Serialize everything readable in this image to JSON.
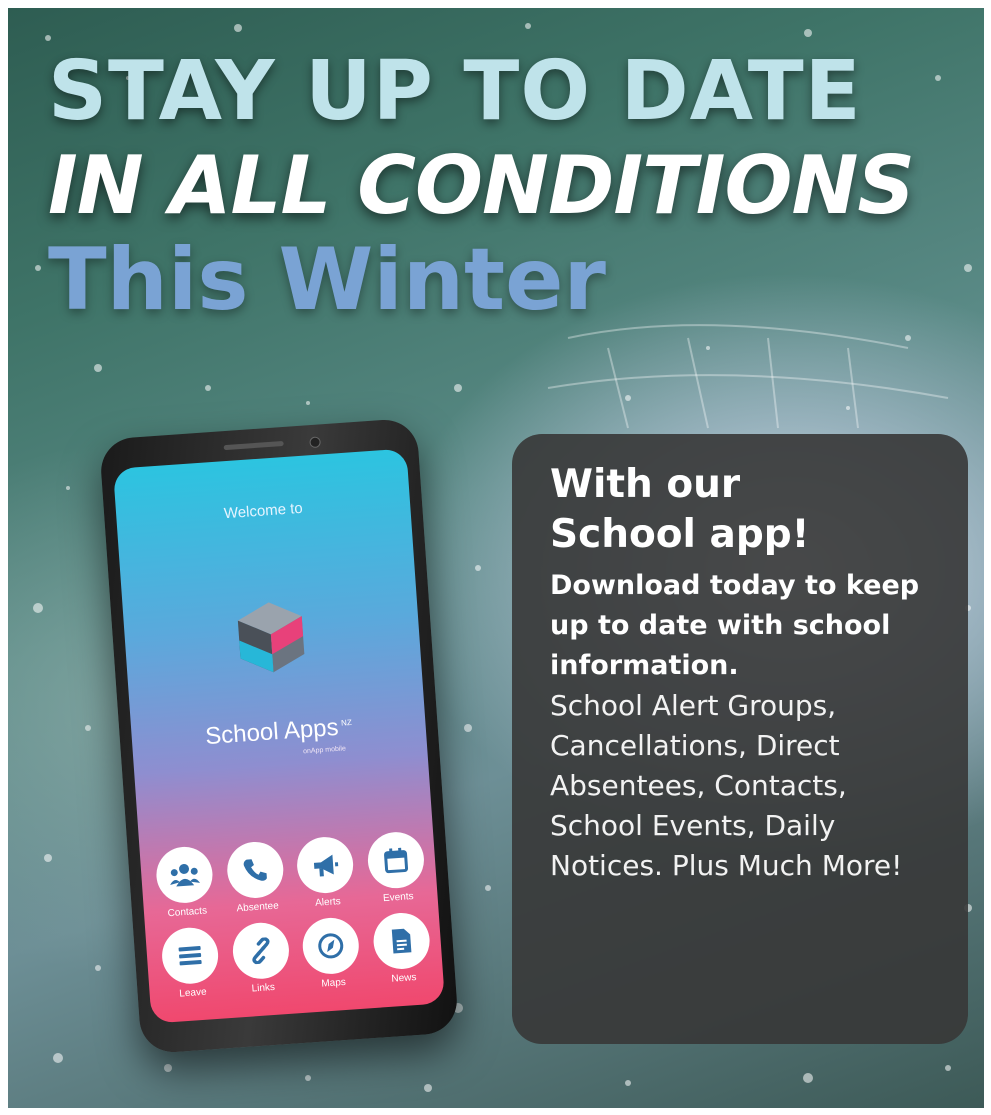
{
  "headline": {
    "line1": "STAY UP TO DATE",
    "line2": "IN ALL CONDITIONS",
    "line3": "This Winter"
  },
  "phone": {
    "welcome": "Welcome to",
    "brand": "School Apps",
    "brand_sup": "NZ",
    "brand_sub": "onApp mobile",
    "tiles": [
      {
        "label": "Contacts",
        "icon": "contacts-icon"
      },
      {
        "label": "Absentee",
        "icon": "phone-icon"
      },
      {
        "label": "Alerts",
        "icon": "megaphone-icon"
      },
      {
        "label": "Events",
        "icon": "calendar-icon"
      },
      {
        "label": "Leave",
        "icon": "menu-lines-icon"
      },
      {
        "label": "Links",
        "icon": "link-icon"
      },
      {
        "label": "Maps",
        "icon": "compass-icon"
      },
      {
        "label": "News",
        "icon": "document-icon"
      }
    ],
    "icon_color": "#2f6fa8"
  },
  "info": {
    "title_line1": "With our",
    "title_line2": "School app!",
    "lead": "Download today to keep up to date with school information.",
    "body": "School Alert Groups, Cancellations, Direct Absentees, Contacts, School Events, Daily Notices. Plus Much More!"
  },
  "colors": {
    "headline1": "#bfe3ea",
    "headline2": "#ffffff",
    "headline3": "#7aa3d4",
    "box": "#373737"
  }
}
